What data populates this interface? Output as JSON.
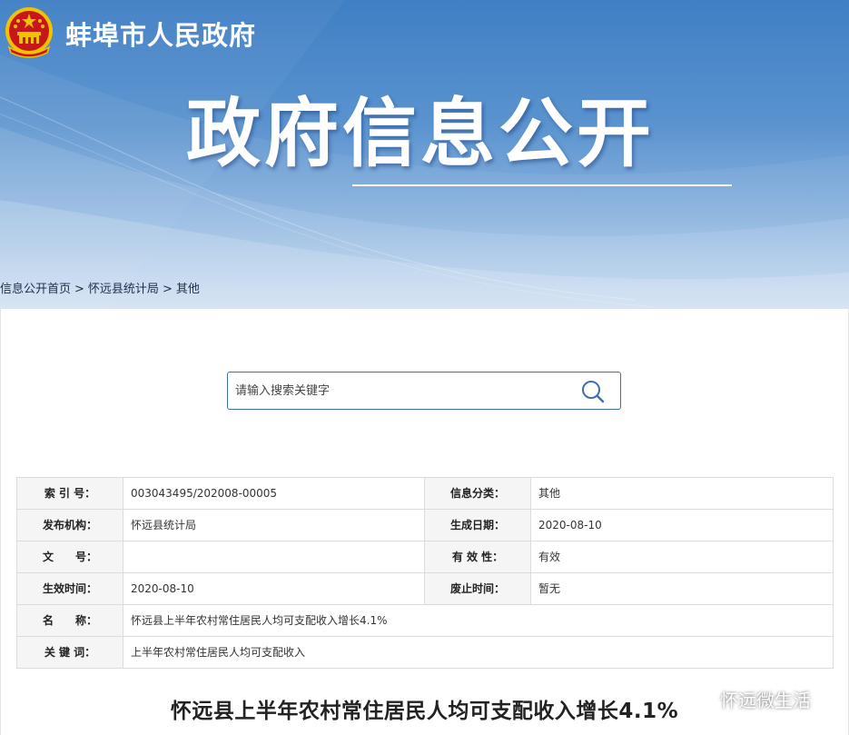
{
  "header": {
    "site_name": "蚌埠市人民政府",
    "banner_title": "政府信息公开",
    "emblem_icon": "national-emblem",
    "colors": {
      "banner_blue": "#3f7fc4",
      "emblem_red": "#c8161d",
      "emblem_gold": "#f2c200"
    }
  },
  "breadcrumb": {
    "items": [
      "信息公开首页",
      "怀远县统计局",
      "其他"
    ],
    "separator": ">"
  },
  "search": {
    "placeholder": "请输入搜索关键字",
    "value": "",
    "icon": "search-icon"
  },
  "info": {
    "index_no": {
      "label": "索 引 号：",
      "value": "003043495/202008-00005"
    },
    "category": {
      "label": "信息分类：",
      "value": "其他"
    },
    "publisher": {
      "label": "发布机构：",
      "value": "怀远县统计局"
    },
    "created_date": {
      "label": "生成日期：",
      "value": "2020-08-10"
    },
    "doc_no": {
      "label": "文　　号：",
      "value": ""
    },
    "validity": {
      "label": "有 效 性：",
      "value": "有效"
    },
    "effective_date": {
      "label": "生效时间：",
      "value": "2020-08-10"
    },
    "expire_date": {
      "label": "废止时间：",
      "value": "暂无"
    },
    "name": {
      "label": "名　　称：",
      "value": "怀远县上半年农村常住居民人均可支配收入增长4.1%"
    },
    "keywords": {
      "label": "关 键 词：",
      "value": "上半年农村常住居民人均可支配收入"
    }
  },
  "article": {
    "title": "怀远县上半年农村常住居民人均可支配收入增长4.1%"
  },
  "watermark": {
    "text": "怀远微生活",
    "icon": "wechat-icon"
  }
}
